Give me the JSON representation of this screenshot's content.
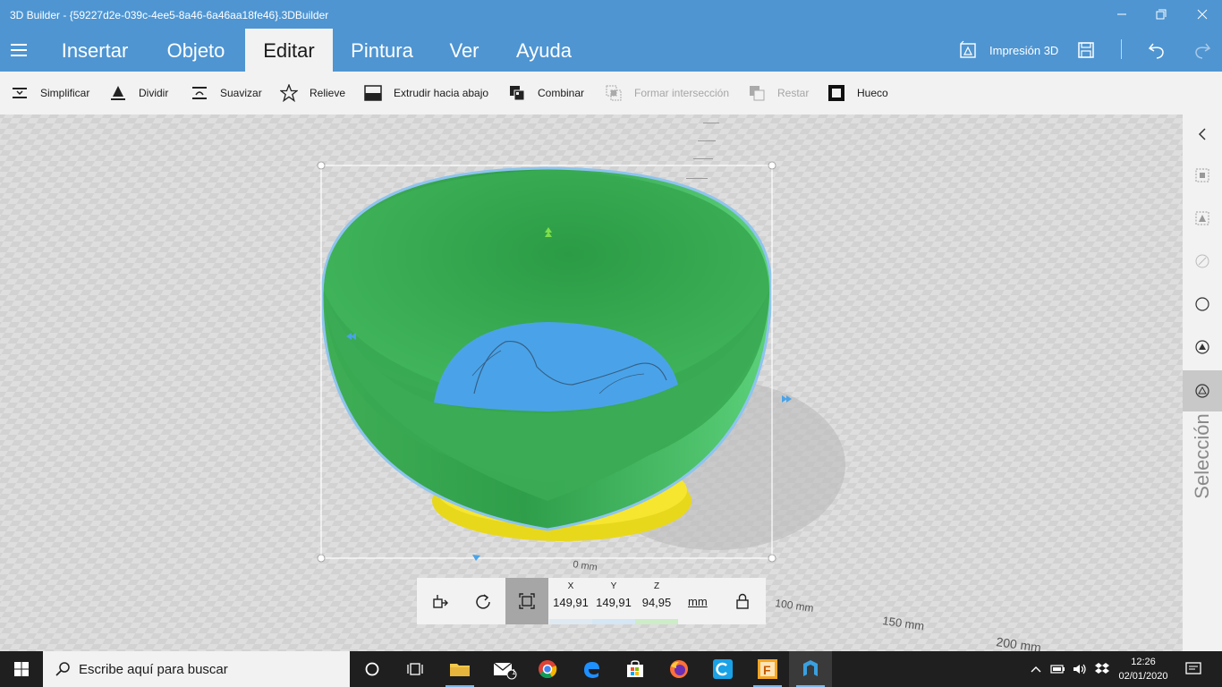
{
  "window": {
    "title": "3D Builder - {59227d2e-039c-4ee5-8a46-6a46aa18fe46}.3DBuilder"
  },
  "ribbon": {
    "tabs": [
      "Insertar",
      "Objeto",
      "Editar",
      "Pintura",
      "Ver",
      "Ayuda"
    ],
    "active_tab": "Editar",
    "print_label": "Impresión 3D"
  },
  "commands": [
    {
      "label": "Simplificar",
      "icon": "simplify-icon",
      "enabled": true
    },
    {
      "label": "Dividir",
      "icon": "split-icon",
      "enabled": true
    },
    {
      "label": "Suavizar",
      "icon": "smooth-icon",
      "enabled": true
    },
    {
      "label": "Relieve",
      "icon": "emboss-star-icon",
      "enabled": true
    },
    {
      "label": "Extrudir hacia abajo",
      "icon": "extrude-down-icon",
      "enabled": true
    },
    {
      "label": "Combinar",
      "icon": "merge-icon",
      "enabled": true
    },
    {
      "label": "Formar intersección",
      "icon": "intersect-icon",
      "enabled": false
    },
    {
      "label": "Restar",
      "icon": "subtract-icon",
      "enabled": false
    },
    {
      "label": "Hueco",
      "icon": "hollow-icon",
      "enabled": true
    }
  ],
  "viewport": {
    "ruler_labels": [
      "0 mm",
      "100 mm",
      "150 mm",
      "200 mm"
    ],
    "model_colors": {
      "bowl": "#3ec45a",
      "inner": "#4aa3e8",
      "base": "#f0e020"
    }
  },
  "side_panel": {
    "label": "Selección"
  },
  "measure": {
    "x_label": "X",
    "x_value": "149,91",
    "y_label": "Y",
    "y_value": "149,91",
    "z_label": "Z",
    "z_value": "94,95",
    "unit": "mm"
  },
  "taskbar": {
    "search_placeholder": "Escribe aquí para buscar",
    "mail_badge": "1",
    "time": "12:26",
    "date": "02/01/2020"
  }
}
